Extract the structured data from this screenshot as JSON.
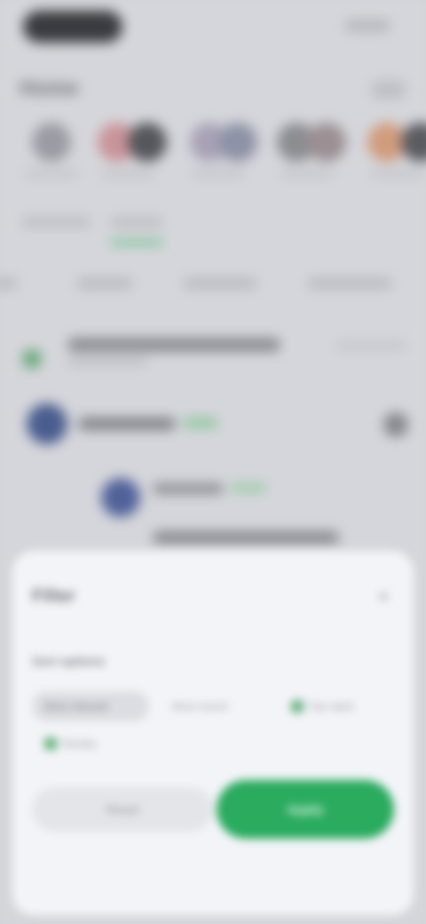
{
  "status_bar": {
    "time": "9:41",
    "indicators": "signal-wifi-battery"
  },
  "header": {
    "title": "Home",
    "action_label": "Edit"
  },
  "stories": [
    {
      "label": "Story",
      "color": "#9a9ca3"
    },
    {
      "label": "Story",
      "color": "#c9949a"
    },
    {
      "label": "Story",
      "color": "#a9a2b6"
    },
    {
      "label": "Story",
      "color": "#9b8f93"
    },
    {
      "label": "Story",
      "color": "#d19c7d"
    }
  ],
  "subtabs": {
    "items": [
      "Following",
      "For you"
    ],
    "active_index": 1
  },
  "main_tabs": [
    "Latest",
    "Top",
    "Media",
    "Discussions"
  ],
  "feed": {
    "banner_text": "Suggested for you in your network",
    "banner_sub": "Sponsored",
    "banner_right": "See all",
    "post": {
      "name": "Community",
      "tag": "Live"
    },
    "reply": {
      "name": "Member",
      "tag": "New",
      "text": "Reply from the community"
    }
  },
  "sheet": {
    "title": "Filter",
    "section": "Sort options",
    "options": [
      {
        "label": "Most relevant",
        "checked": false,
        "selected": true
      },
      {
        "label": "Most recent",
        "checked": false,
        "selected": false
      },
      {
        "label": "Top rated",
        "checked": true,
        "selected": false
      },
      {
        "label": "Nearby",
        "checked": true,
        "selected": false
      }
    ],
    "cancel_label": "Reset",
    "confirm_label": "Apply"
  },
  "colors": {
    "accent": "#2aab5e",
    "sheet_bg": "#f3f4f8",
    "backdrop": "#d5d6db"
  }
}
